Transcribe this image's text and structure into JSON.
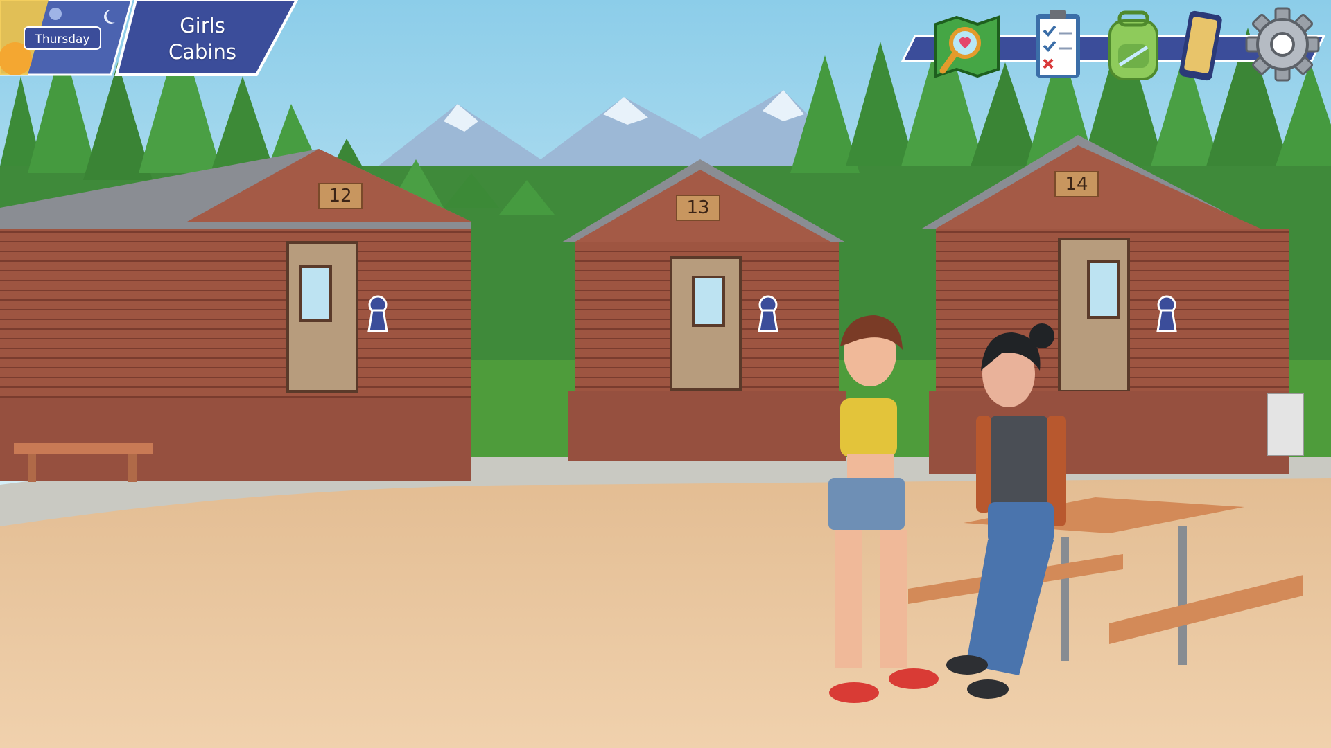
{
  "hud": {
    "day": "Thursday",
    "location_line1": "Girls",
    "location_line2": "Cabins"
  },
  "toolbar": {
    "icons": [
      "map-icon",
      "checklist-icon",
      "backpack-icon",
      "phone-icon",
      "gear-icon"
    ]
  },
  "cabins": [
    {
      "number": "12"
    },
    {
      "number": "13"
    },
    {
      "number": "14"
    }
  ],
  "colors": {
    "hud_blue": "#3b4d9a",
    "cabin_wood": "#9a5441",
    "ground": "#ecc9a2"
  }
}
